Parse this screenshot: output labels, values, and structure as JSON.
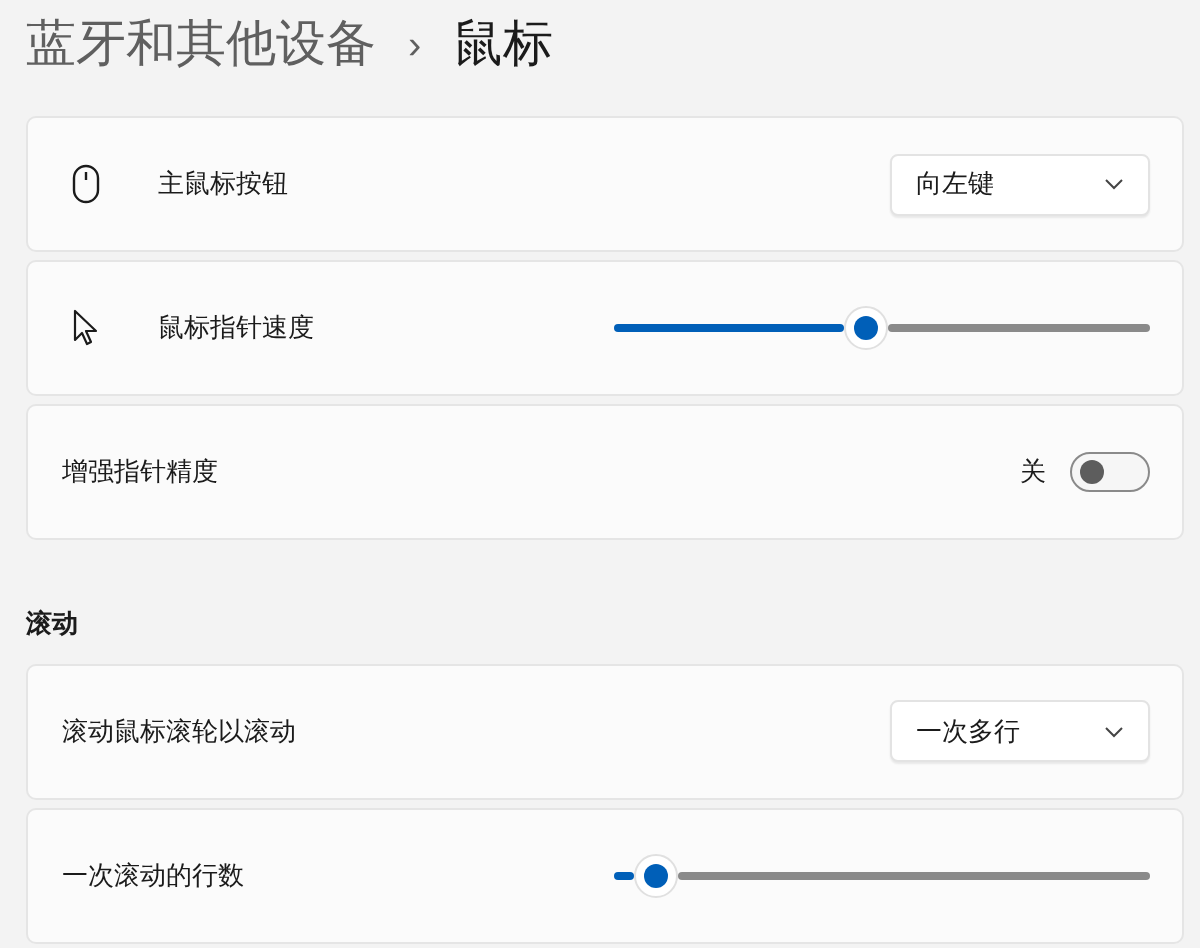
{
  "breadcrumb": {
    "parent": "蓝牙和其他设备",
    "separator": "›",
    "current": "鼠标"
  },
  "groups": [
    {
      "rows": [
        {
          "kind": "dropdown",
          "label": "主鼠标按钮",
          "value": "向左键"
        },
        {
          "kind": "slider",
          "label": "鼠标指针速度",
          "level": 0.47
        },
        {
          "kind": "toggle",
          "label": "增强指针精度",
          "on": false,
          "state_text": "关"
        }
      ]
    },
    {
      "heading": "滚动",
      "rows": [
        {
          "kind": "dropdown",
          "label": "滚动鼠标滚轮以滚动",
          "value": "一次多行"
        },
        {
          "kind": "slider",
          "label": "一次滚动的行数",
          "level": 0.08
        }
      ]
    }
  ]
}
